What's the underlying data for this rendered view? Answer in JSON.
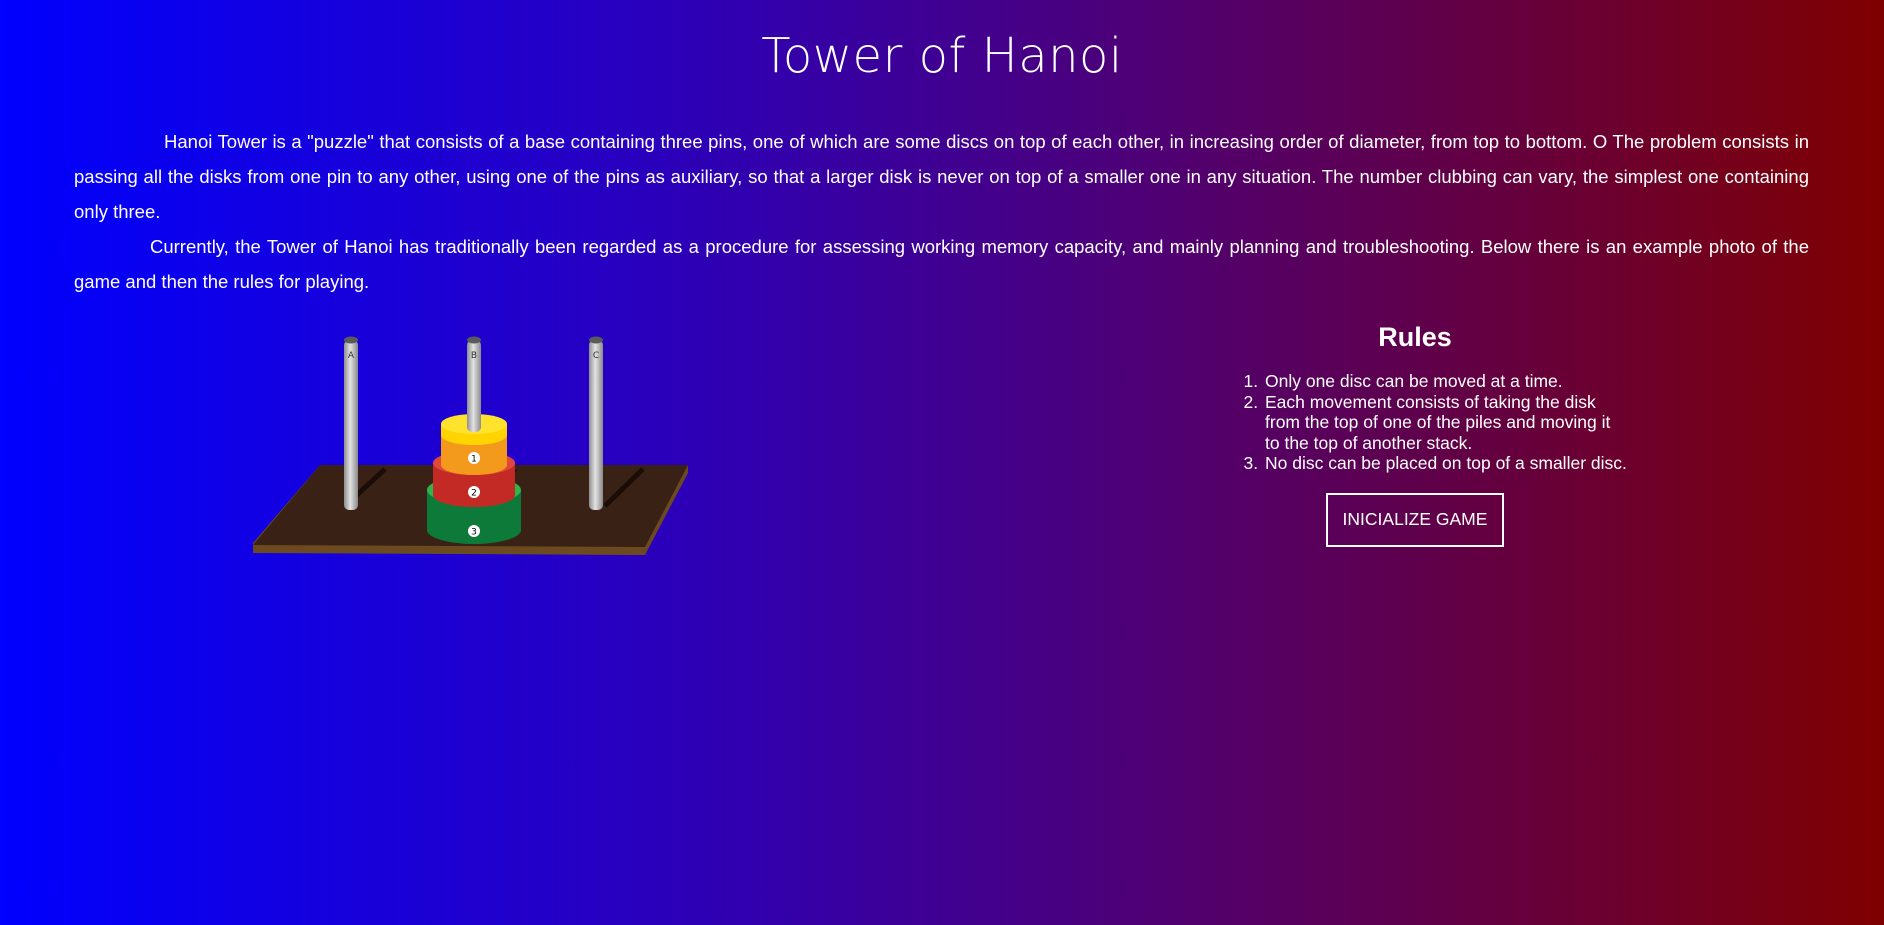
{
  "title": "Tower of Hanoi",
  "intro": {
    "paragraph1": "Hanoi Tower is a \"puzzle\" that consists of a base containing three pins, one of which are some discs on top of each other, in increasing order of diameter, from top to bottom. O The problem consists in passing all the disks from one pin to any other, using one of the pins as auxiliary, so that a larger disk is never on top of a smaller one in any situation. The number clubbing can vary, the simplest one containing only three.",
    "paragraph2": "Currently, the Tower of Hanoi has traditionally been regarded as a procedure for assessing working memory capacity, and mainly planning and troubleshooting. Below there is an example photo of the game and then the rules for playing."
  },
  "game_photo": {
    "pins": [
      "A",
      "B",
      "C"
    ],
    "discs": [
      "1",
      "2",
      "3"
    ],
    "colors": {
      "base": "#3a2116",
      "base_edge": "#6b4a1f",
      "pin": "#b9b9b9",
      "disc_top": "#ffd400",
      "disc_1": "#f39a1c",
      "disc_2": "#d4302a",
      "disc_3": "#0e7a3a",
      "disc_3_rim": "#2fb34a"
    }
  },
  "rules": {
    "heading": "Rules",
    "items": [
      "Only one disc can be moved at a time.",
      "Each movement consists of taking the disk from the top of one of the piles and moving it to the top of another stack.",
      "No disc can be placed on top of a smaller disc."
    ]
  },
  "button": {
    "label": "INICIALIZE GAME"
  }
}
